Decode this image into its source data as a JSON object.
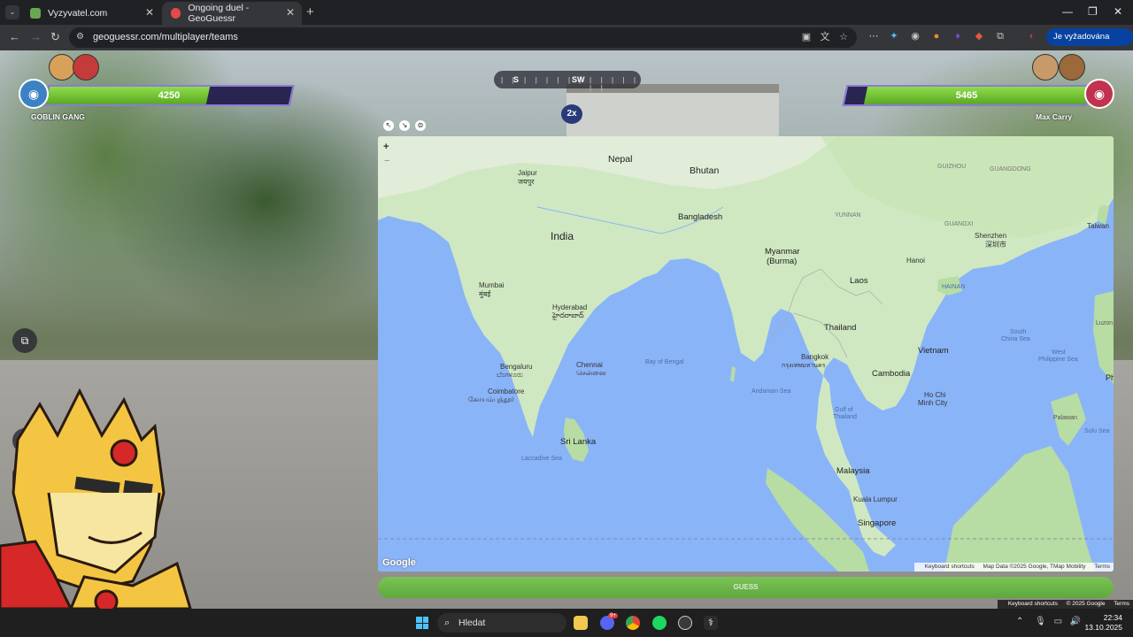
{
  "browser": {
    "tabs": [
      {
        "title": "Vyzyvatel.com",
        "active": false
      },
      {
        "title": "Ongoing duel - GeoGuessr",
        "active": true
      }
    ],
    "url": "geoguessr.com/multiplayer/teams",
    "action_button": "Je vyžadována akce"
  },
  "game": {
    "left_team": {
      "name": "GOBLIN GANG",
      "score": "4250",
      "health_fraction": 0.66,
      "color": "#3b82c4"
    },
    "right_team": {
      "name": "Max Carry",
      "score": "5465",
      "health_fraction": 0.92,
      "color": "#c0324f"
    },
    "compass": {
      "left_label": "S",
      "right_label": "SW"
    },
    "multiplier": "2x",
    "guess_button": "GUESS",
    "keyboard_shortcuts": "Keyboard shortcuts",
    "copyright": "© 2025 Google",
    "terms": "Terms"
  },
  "map": {
    "zoom_in": "+",
    "zoom_out": "−",
    "logo": "Google",
    "footer": {
      "shortcuts": "Keyboard shortcuts",
      "data": "Map Data ©2025 Google, TMap Mobility",
      "terms": "Terms"
    },
    "labels": {
      "nepal": "Nepal",
      "bhutan": "Bhutan",
      "jaipur": "Jaipur",
      "jaipur_native": "जयपुर",
      "india": "India",
      "bangladesh": "Bangladesh",
      "myanmar": "Myanmar",
      "burma": "(Burma)",
      "hanoi": "Hanoi",
      "laos": "Laos",
      "mumbai": "Mumbai",
      "mumbai_native": "मुंबई",
      "hyderabad": "Hyderabad",
      "hyderabad_native": "హైదరాబాద్",
      "thailand": "Thailand",
      "bangkok": "Bangkok",
      "bangkok_native": "กรุงเทพมหานคร",
      "vietnam": "Vietnam",
      "bay_of_bengal": "Bay of Bengal",
      "bengaluru": "Bengaluru",
      "bengaluru_native": "ಬೆಂಗಳೂರು",
      "chennai": "Chennai",
      "chennai_native": "சென்னை",
      "cambodia": "Cambodia",
      "andaman_sea": "Andaman Sea",
      "coimbatore": "Coimbatore",
      "coimbatore_native": "கோயம்புத்தூர்",
      "ho_chi_minh": "Ho Chi",
      "ho_chi_minh_2": "Minh City",
      "gulf_thailand": "Gulf of",
      "gulf_thailand_2": "Thailand",
      "sri_lanka": "Sri Lanka",
      "laccadive_sea": "Laccadive Sea",
      "malaysia": "Malaysia",
      "kuala_lumpur": "Kuala Lumpur",
      "singapore": "Singapore",
      "shenzhen": "Shenzhen",
      "shenzhen_native": "深圳市",
      "taiwan": "Taiwan",
      "hainan": "HAINAN",
      "south_china_sea": "South",
      "south_china_sea_2": "China Sea",
      "west_philippine": "West",
      "west_philippine_2": "Philippine Sea",
      "guizhou": "GUIZHOU",
      "yunnan": "YUNNAN",
      "guangxi": "GUANGXI",
      "guangdong": "GUANGDONG",
      "sulu_sea": "Sulu Sea",
      "palawan": "Palawan",
      "luzon": "Luzon",
      "ph": "Ph"
    }
  },
  "taskbar": {
    "search": "Hledat",
    "time": "22:34",
    "date": "13.10.2025",
    "discord_badge": "9+"
  }
}
